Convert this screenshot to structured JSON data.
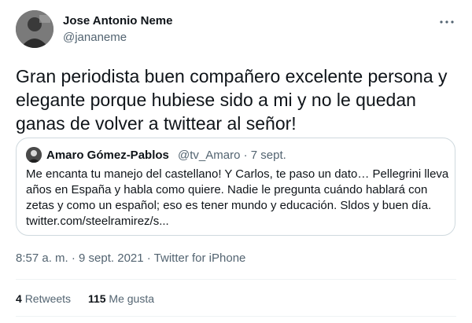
{
  "tweet": {
    "author": {
      "name": "Jose Antonio Neme",
      "handle": "@jananeme"
    },
    "text": "Gran periodista buen compañero excelente persona y elegante porque hubiese sido a mi y no le quedan ganas de volver a twittear al señor!",
    "quoted": {
      "name": "Amaro Gómez-Pablos",
      "meta": "@tv_Amaro · 7 sept.",
      "text": "Me encanta tu manejo del castellano! Y Carlos, te paso un dato… Pellegrini lleva años en España y habla como quiere. Nadie le pregunta cuándo hablará con zetas y como un español; eso es tener mundo y educación. Sldos y buen día. twitter.com/steelramirez/s..."
    },
    "timestamp": "8:57 a. m. · 9 sept. 2021 · Twitter for iPhone",
    "stats": {
      "retweets_count": "4",
      "retweets_label": "Retweets",
      "likes_count": "115",
      "likes_label": "Me gusta"
    }
  },
  "icons": {
    "more": "more-horizontal-icon"
  }
}
